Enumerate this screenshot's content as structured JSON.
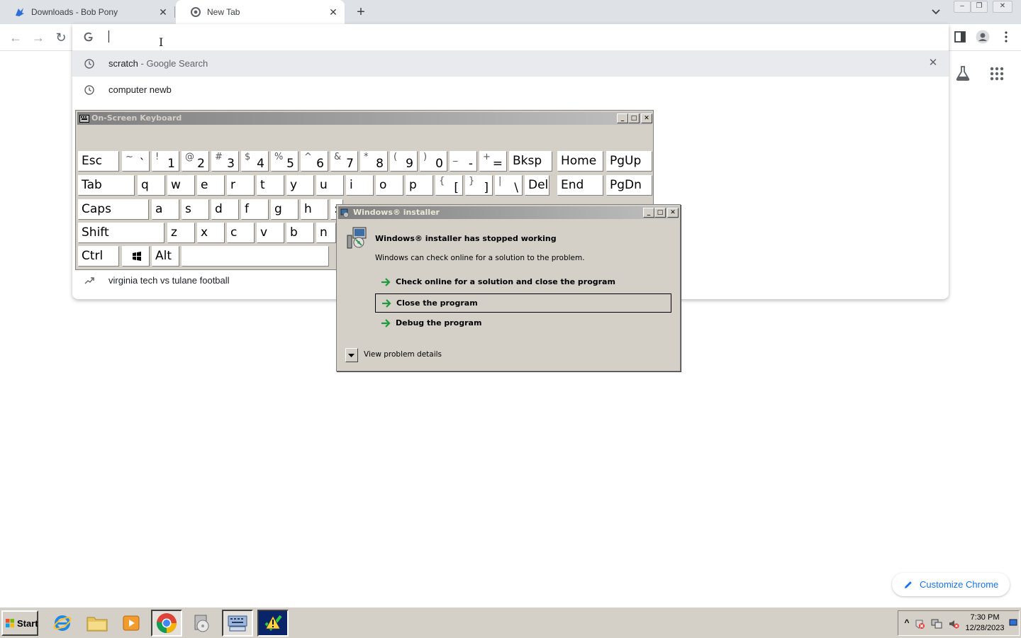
{
  "browser": {
    "tabs": [
      {
        "title": "Downloads - Bob Pony",
        "close": "✕"
      },
      {
        "title": "New Tab",
        "close": "✕"
      }
    ],
    "new_tab": "+",
    "window_controls": {
      "minimize": "–",
      "restore": "❐",
      "close": "✕"
    }
  },
  "toolbar": {
    "back": "←",
    "forward": "→",
    "reload": "↻",
    "address_value": ""
  },
  "omnibox": {
    "cursor": "I",
    "suggestions": [
      {
        "icon": "history-icon",
        "text": "scratch",
        "sub": " - Google Search",
        "remove": "✕",
        "selected": true
      },
      {
        "icon": "history-icon",
        "text": "computer newb",
        "selected": false
      },
      {
        "icon": "trending-icon",
        "text": "virginia tech vs tulane football",
        "selected": false
      }
    ]
  },
  "ntp": {
    "customize_label": "Customize Chrome"
  },
  "osk": {
    "title": "On-Screen Keyboard",
    "title_buttons": {
      "minimize": "_",
      "maximize": "□",
      "close": "✕"
    },
    "row1": [
      {
        "main": "Esc"
      },
      {
        "shift": "~",
        "base": "`"
      },
      {
        "shift": "!",
        "base": "1"
      },
      {
        "shift": "@",
        "base": "2"
      },
      {
        "shift": "#",
        "base": "3"
      },
      {
        "shift": "$",
        "base": "4"
      },
      {
        "shift": "%",
        "base": "5"
      },
      {
        "shift": "^",
        "base": "6"
      },
      {
        "shift": "&",
        "base": "7"
      },
      {
        "shift": "*",
        "base": "8"
      },
      {
        "shift": "(",
        "base": "9"
      },
      {
        "shift": ")",
        "base": "0"
      },
      {
        "shift": "_",
        "base": "-"
      },
      {
        "shift": "+",
        "base": "="
      },
      {
        "main": "Bksp"
      },
      {
        "main": "Home"
      },
      {
        "main": "PgUp"
      }
    ],
    "row2": [
      {
        "main": "Tab"
      },
      {
        "main": "q"
      },
      {
        "main": "w"
      },
      {
        "main": "e"
      },
      {
        "main": "r"
      },
      {
        "main": "t"
      },
      {
        "main": "y"
      },
      {
        "main": "u"
      },
      {
        "main": "i"
      },
      {
        "main": "o"
      },
      {
        "main": "p"
      },
      {
        "shift": "{",
        "base": "["
      },
      {
        "shift": "}",
        "base": "]"
      },
      {
        "shift": "|",
        "base": "\\"
      },
      {
        "main": "Del"
      },
      {
        "main": "End"
      },
      {
        "main": "PgDn"
      }
    ],
    "row3": [
      {
        "main": "Caps"
      },
      {
        "main": "a"
      },
      {
        "main": "s"
      },
      {
        "main": "d"
      },
      {
        "main": "f"
      },
      {
        "main": "g"
      },
      {
        "main": "h"
      },
      {
        "main": ":"
      }
    ],
    "row4": [
      {
        "main": "Shift"
      },
      {
        "main": "z"
      },
      {
        "main": "x"
      },
      {
        "main": "c"
      },
      {
        "main": "v"
      },
      {
        "main": "b"
      },
      {
        "main": "n"
      }
    ],
    "row5": [
      {
        "main": "Ctrl"
      },
      {
        "main": ""
      },
      {
        "main": "Alt"
      },
      {
        "main": ""
      }
    ]
  },
  "dialog": {
    "title": "Windows® installer",
    "title_buttons": {
      "minimize": "_",
      "maximize": "□",
      "close": "✕"
    },
    "heading": "Windows® installer has stopped working",
    "description": "Windows can check online for a solution to the problem.",
    "commands": [
      {
        "label": "Check online for a solution and close the program",
        "selected": false
      },
      {
        "label": "Close the program",
        "selected": true
      },
      {
        "label": "Debug the program",
        "selected": false
      }
    ],
    "details_label": "View problem details"
  },
  "taskbar": {
    "start_label": "Start",
    "items": [
      {
        "icon": "internet-explorer-icon"
      },
      {
        "icon": "folder-icon"
      },
      {
        "icon": "media-player-icon"
      },
      {
        "icon": "chrome-icon"
      },
      {
        "icon": "installer-cd-icon"
      },
      {
        "icon": "keyboard-icon"
      },
      {
        "icon": "error-reporting-icon"
      }
    ],
    "tray_expand": "^",
    "clock_time": "7:30 PM",
    "clock_date": "12/28/2023"
  }
}
